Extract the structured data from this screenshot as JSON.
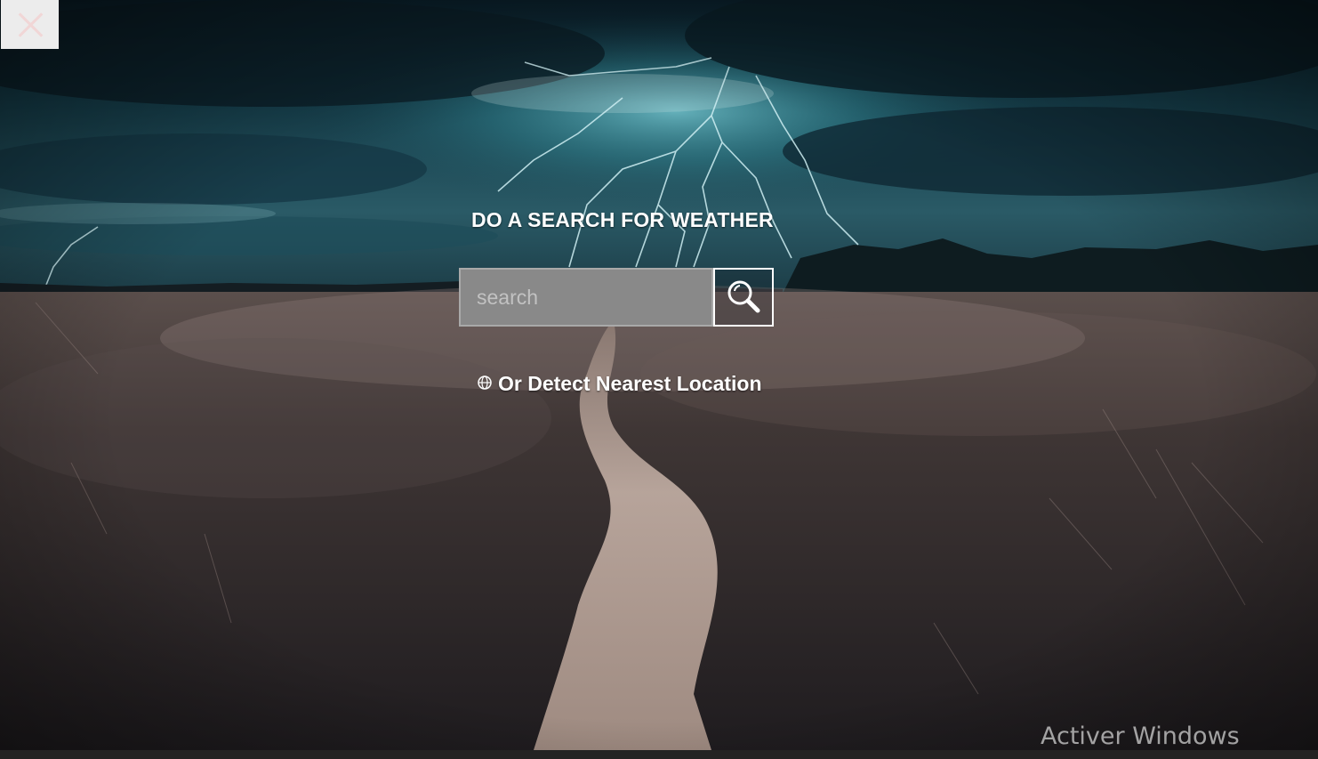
{
  "app": {
    "heading": "DO A SEARCH FOR WEATHER",
    "search": {
      "placeholder": "search",
      "value": "",
      "button_icon": "magnifier-icon"
    },
    "detect_location": {
      "icon": "globe-icon",
      "label": "Or Detect Nearest Location"
    },
    "close_icon": "close-icon"
  },
  "os_watermark": {
    "text": "Activer Windows"
  },
  "colors": {
    "sky_dark": "#0e2a36",
    "sky_teal": "#2f7a86",
    "field": "#3a3230",
    "path": "#c8b3a6",
    "input_bg": "#898989",
    "text": "#ffffff"
  }
}
